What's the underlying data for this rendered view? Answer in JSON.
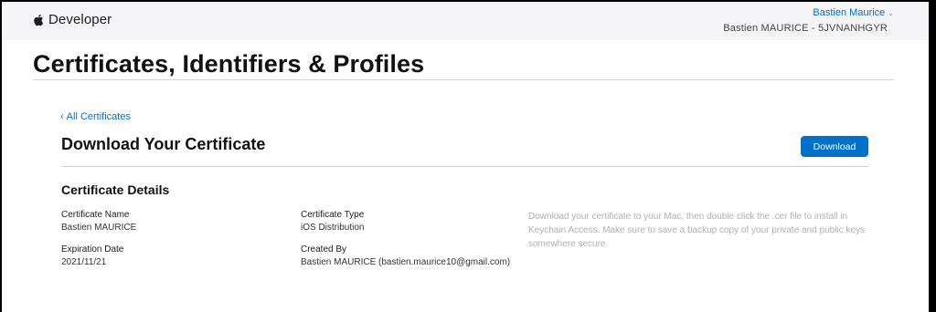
{
  "header": {
    "brand_label": "Developer",
    "user_name": "Bastien Maurice",
    "team_line": "Bastien MAURICE - 5JVNANHGYR"
  },
  "page": {
    "title": "Certificates, Identifiers & Profiles"
  },
  "main": {
    "back_link": "All Certificates",
    "heading": "Download Your Certificate",
    "download_label": "Download",
    "details_title": "Certificate Details",
    "fields": {
      "name_label": "Certificate Name",
      "name_value": "Bastien MAURICE",
      "expiration_label": "Expiration Date",
      "expiration_value": "2021/11/21",
      "type_label": "Certificate Type",
      "type_value": "iOS Distribution",
      "created_label": "Created By",
      "created_value": "Bastien MAURICE (bastien.maurice10@gmail.com)"
    },
    "help_text": "Download your certificate to your Mac, then double click the .cer file to install in Keychain Access. Make sure to save a backup copy of your private and public keys somewhere secure."
  },
  "icons": {
    "brand": "apple-logo-icon",
    "user_menu": "chevron-down-icon",
    "back": "chevron-left-icon"
  },
  "colors": {
    "accent": "#0070c9",
    "header_bg": "#f5f5f7",
    "help_text": "#b0b0b5"
  }
}
